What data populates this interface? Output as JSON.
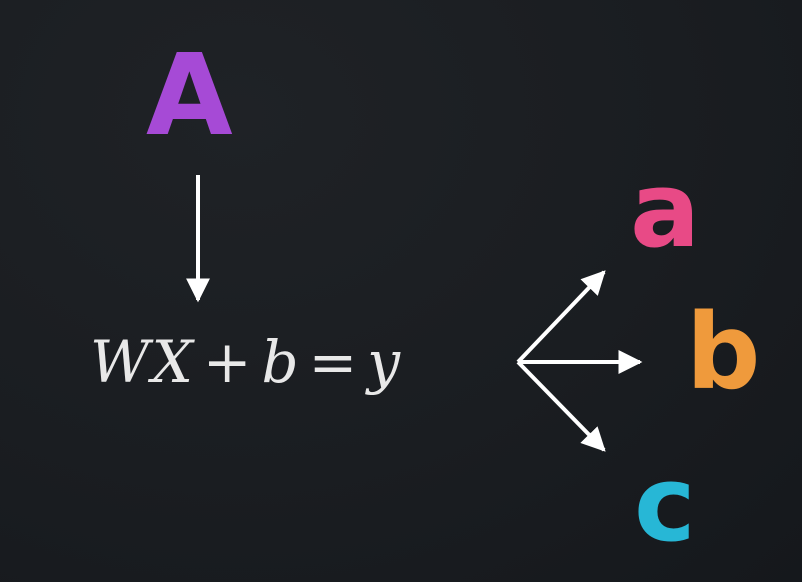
{
  "input": {
    "label": "A",
    "color": "#a64ad6"
  },
  "equation": {
    "w": "W",
    "x": "X",
    "plus": "+",
    "b": "b",
    "equals": "=",
    "y": "y"
  },
  "outputs": [
    {
      "label": "a",
      "color": "#e84a86"
    },
    {
      "label": "b",
      "color": "#ef9a3c"
    },
    {
      "label": "c",
      "color": "#27b7d6"
    }
  ],
  "arrow_color": "#ffffff"
}
